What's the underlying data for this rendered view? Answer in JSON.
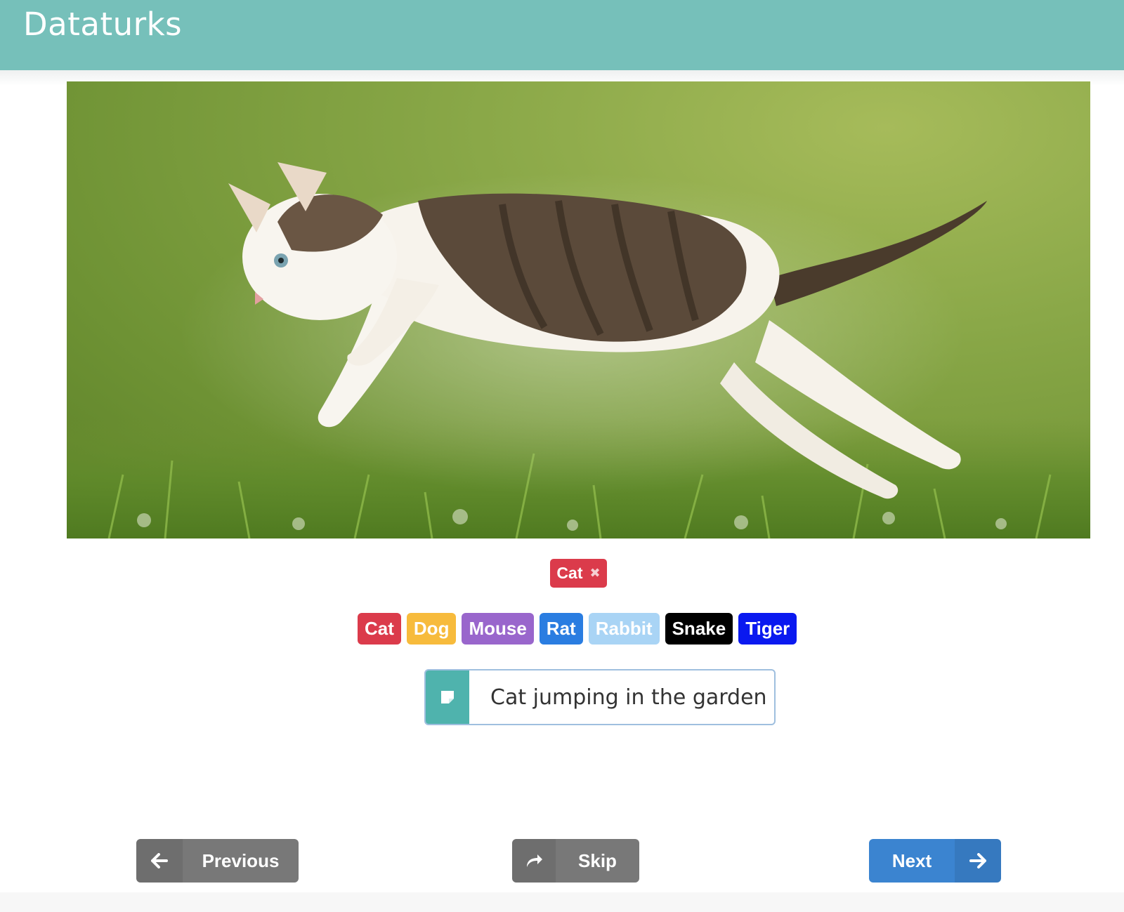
{
  "header": {
    "title": "Dataturks"
  },
  "image": {
    "alt": "Cat jumping in the garden"
  },
  "selected_label": {
    "text": "Cat",
    "color": "#db3b4b"
  },
  "labels": [
    {
      "text": "Cat",
      "color": "#db3b4b"
    },
    {
      "text": "Dog",
      "color": "#f7bb3c"
    },
    {
      "text": "Mouse",
      "color": "#9966cc"
    },
    {
      "text": "Rat",
      "color": "#2a7de1"
    },
    {
      "text": "Rabbit",
      "color": "#a9d4f5"
    },
    {
      "text": "Snake",
      "color": "#000000"
    },
    {
      "text": "Tiger",
      "color": "#0a19f0"
    }
  ],
  "caption": {
    "value": "Cat jumping in the garden",
    "icon": "sticky-note-icon"
  },
  "nav": {
    "previous_label": "Previous",
    "skip_label": "Skip",
    "next_label": "Next"
  }
}
